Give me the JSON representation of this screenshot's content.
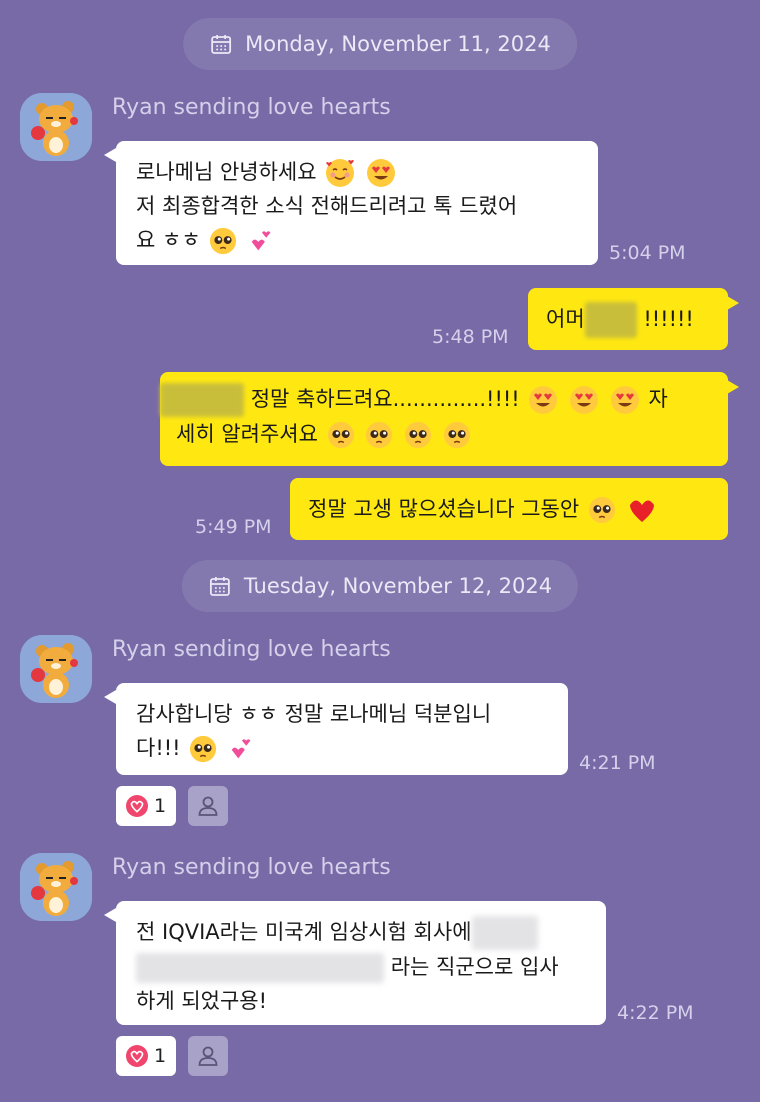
{
  "date_separators": [
    {
      "label": "Monday, November 11, 2024",
      "icon": "calendar-icon"
    },
    {
      "label": "Tuesday, November 12, 2024",
      "icon": "calendar-icon"
    }
  ],
  "sender_name": "Ryan sending love hearts",
  "messages": {
    "m1": {
      "line1": "로나메님 안녕하세요",
      "line2": "저 최종합격한 소식 전해드리려고 톡 드렸어",
      "line3": "요 ㅎㅎ",
      "time": "5:04 PM"
    },
    "m2": {
      "prefix": "어머",
      "suffix": "!!!!!!",
      "time": "5:48 PM"
    },
    "m3": {
      "line1_text": "정말 축하드려요..............!!!!",
      "line1_tail": "자",
      "line2": "세히 알려주셔요"
    },
    "m4": {
      "text": "정말 고생 많으셨습니다 그동안",
      "time": "5:49 PM"
    },
    "m5": {
      "line1": "감사합니당 ㅎㅎ 정말 로나메님 덕분입니",
      "line2": "다!!!",
      "time": "4:21 PM",
      "reaction_count": "1"
    },
    "m6": {
      "line1": "전 IQVIA라는 미국계 임상시험 회사에",
      "line2_suffix": "라는 직군으로 입사",
      "line3": "하게 되었구용!",
      "time": "4:22 PM",
      "reaction_count": "1"
    }
  },
  "colors": {
    "background": "#776AA6",
    "my_bubble": "#FFE812",
    "their_bubble": "#FFFFFF",
    "reaction_heart": "#F0466E"
  }
}
